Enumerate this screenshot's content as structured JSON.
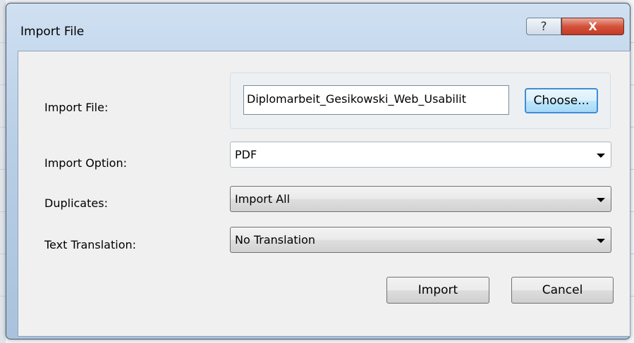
{
  "dialog": {
    "title": "Import File",
    "help_glyph": "?",
    "close_glyph": "X"
  },
  "form": {
    "import_file_label": "Import File:",
    "import_file_value": "Diplomarbeit_Gesikowski_Web_Usabilit",
    "choose_label": "Choose...",
    "import_option_label": "Import Option:",
    "import_option_value": "PDF",
    "duplicates_label": "Duplicates:",
    "duplicates_value": "Import All",
    "text_translation_label": "Text Translation:",
    "text_translation_value": "No Translation"
  },
  "buttons": {
    "import_label": "Import",
    "cancel_label": "Cancel"
  },
  "icons": [
    "help-icon",
    "close-icon",
    "dropdown-arrow-icon"
  ],
  "colors": {
    "close_button": "#c23b25",
    "focus_button_border": "#3c8ed6"
  }
}
